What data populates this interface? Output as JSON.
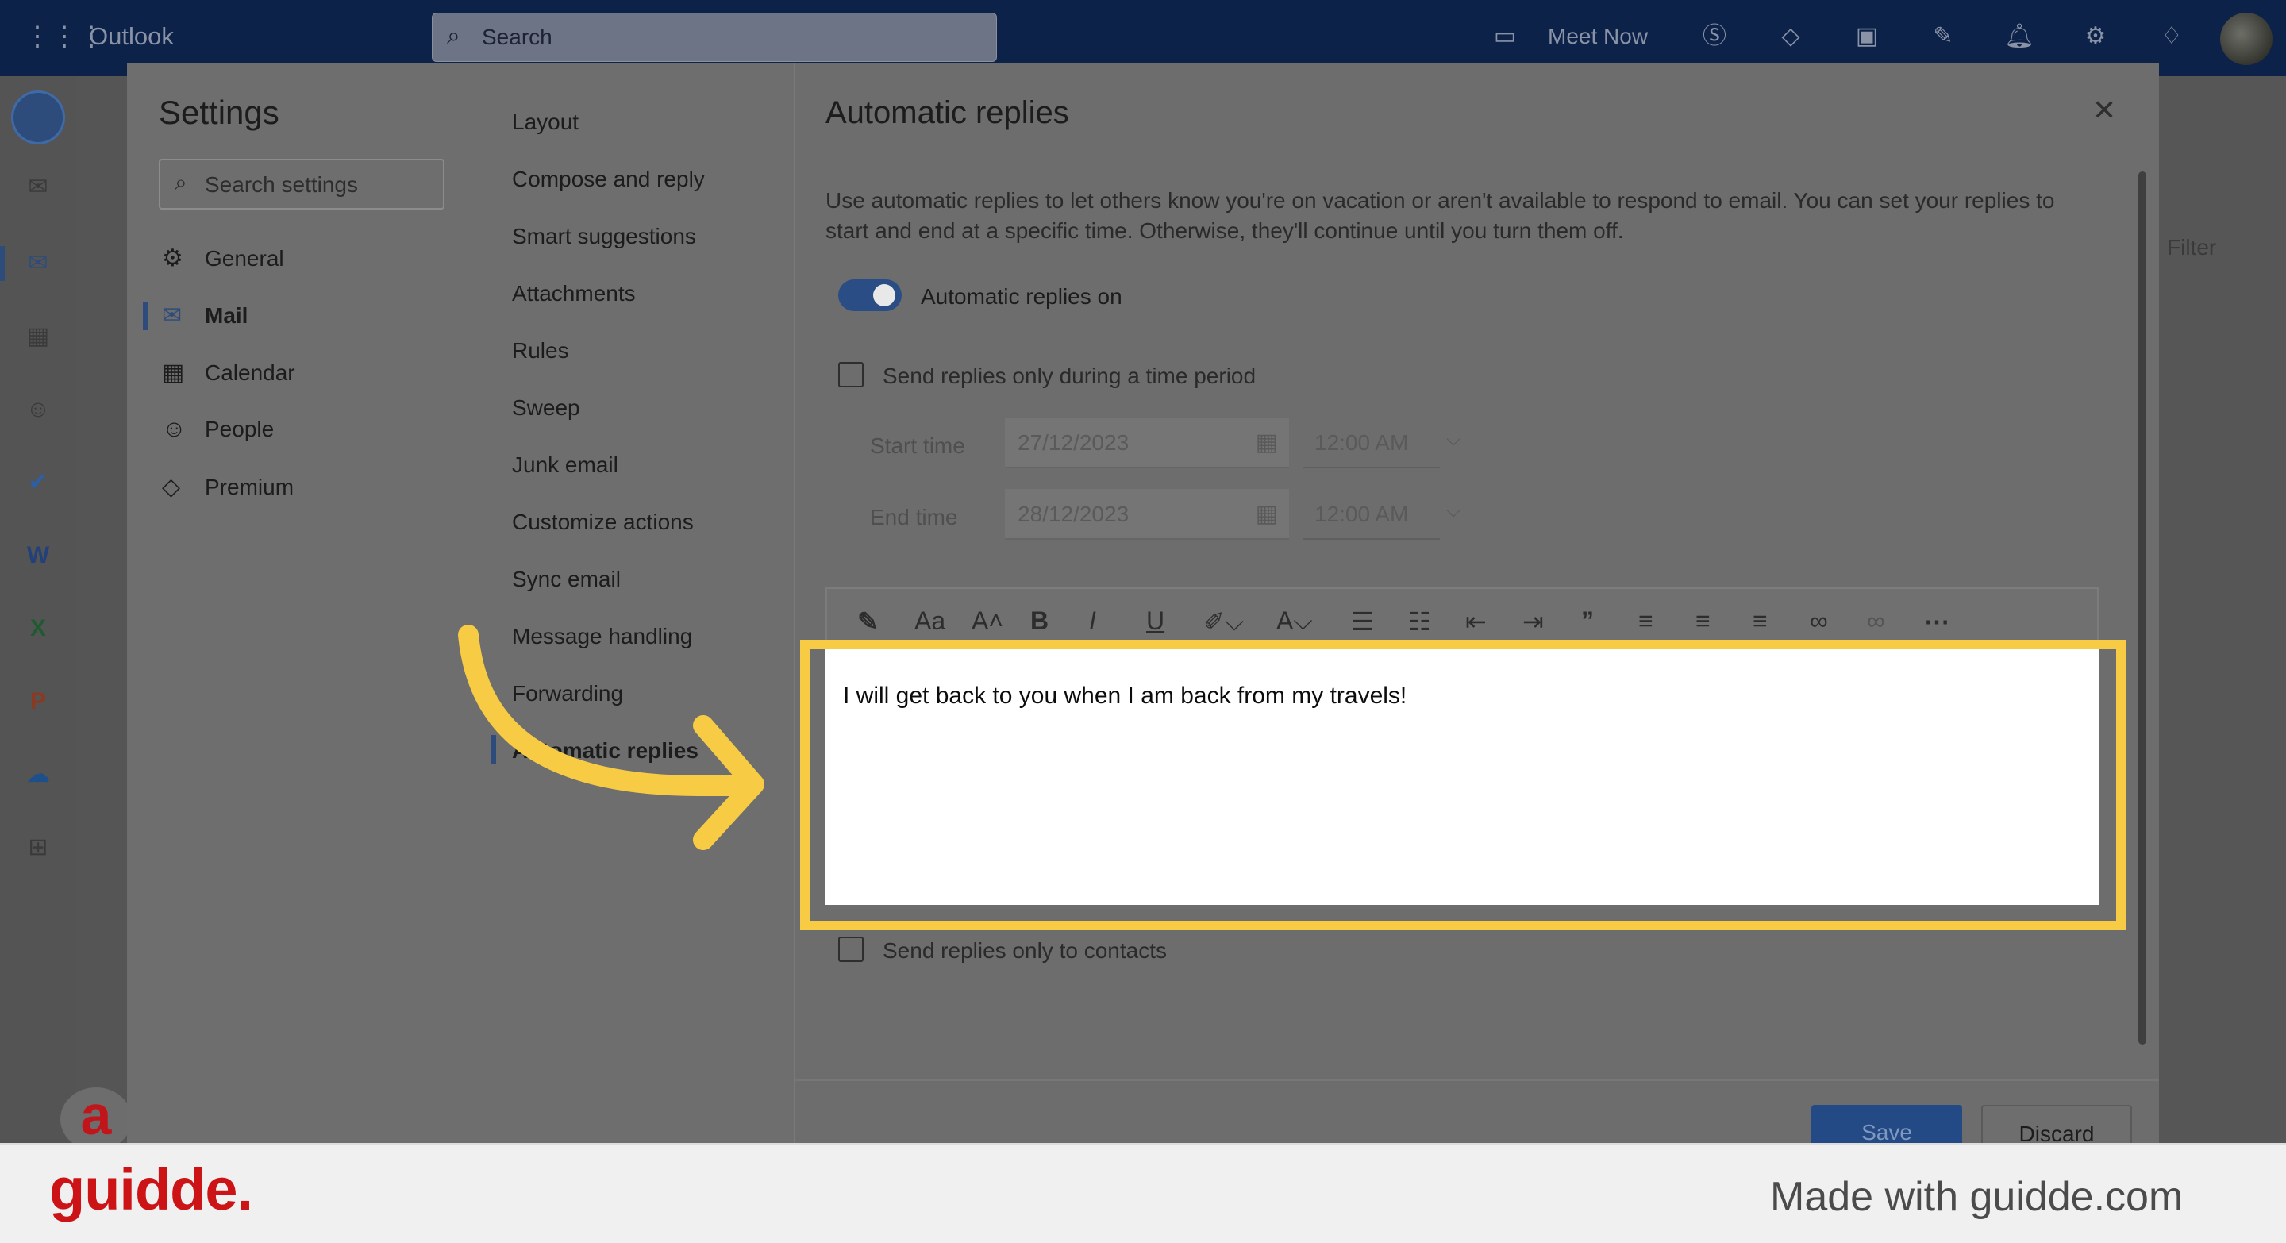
{
  "app": {
    "name": "Outlook",
    "search_placeholder": "Search",
    "meet_now": "Meet Now"
  },
  "settings": {
    "title": "Settings",
    "search_placeholder": "Search settings",
    "nav": [
      {
        "label": "General",
        "icon": "gear-icon"
      },
      {
        "label": "Mail",
        "icon": "mail-icon",
        "selected": true
      },
      {
        "label": "Calendar",
        "icon": "calendar-icon"
      },
      {
        "label": "People",
        "icon": "people-icon"
      },
      {
        "label": "Premium",
        "icon": "diamond-icon"
      }
    ],
    "subnav": [
      "Layout",
      "Compose and reply",
      "Smart suggestions",
      "Attachments",
      "Rules",
      "Sweep",
      "Junk email",
      "Customize actions",
      "Sync email",
      "Message handling",
      "Forwarding",
      "Automatic replies"
    ],
    "subnav_selected": "Automatic replies"
  },
  "auto_replies": {
    "title": "Automatic replies",
    "description": "Use automatic replies to let others know you're on vacation or aren't available to respond to email. You can set your replies to start and end at a specific time. Otherwise, they'll continue until you turn them off.",
    "toggle_label": "Automatic replies on",
    "toggle_on": true,
    "period_label": "Send replies only during a time period",
    "period_checked": false,
    "start_label": "Start time",
    "start_date": "27/12/2023",
    "start_time": "12:00 AM",
    "end_label": "End time",
    "end_date": "28/12/2023",
    "end_time": "12:00 AM",
    "message": "I will get back to you when I am back from my travels!",
    "contacts_label": "Send replies only to contacts",
    "contacts_checked": false,
    "save_label": "Save",
    "discard_label": "Discard"
  },
  "toolbar_icons": [
    "format-painter-icon",
    "font-size-icon",
    "grow-font-icon",
    "bold-icon",
    "italic-icon",
    "underline-icon",
    "highlight-icon",
    "font-color-icon",
    "bullets-icon",
    "numbering-icon",
    "outdent-icon",
    "indent-icon",
    "quote-icon",
    "align-left-icon",
    "align-center-icon",
    "align-right-icon",
    "link-icon",
    "unlink-icon",
    "more-icon"
  ],
  "background": {
    "filter_label": "Filter"
  },
  "branding": {
    "logo": "guidde.",
    "made_with": "Made with guidde.com"
  },
  "colors": {
    "accent": "#f7cc44",
    "brand_red": "#cc1316",
    "primary_blue": "#244a85"
  }
}
